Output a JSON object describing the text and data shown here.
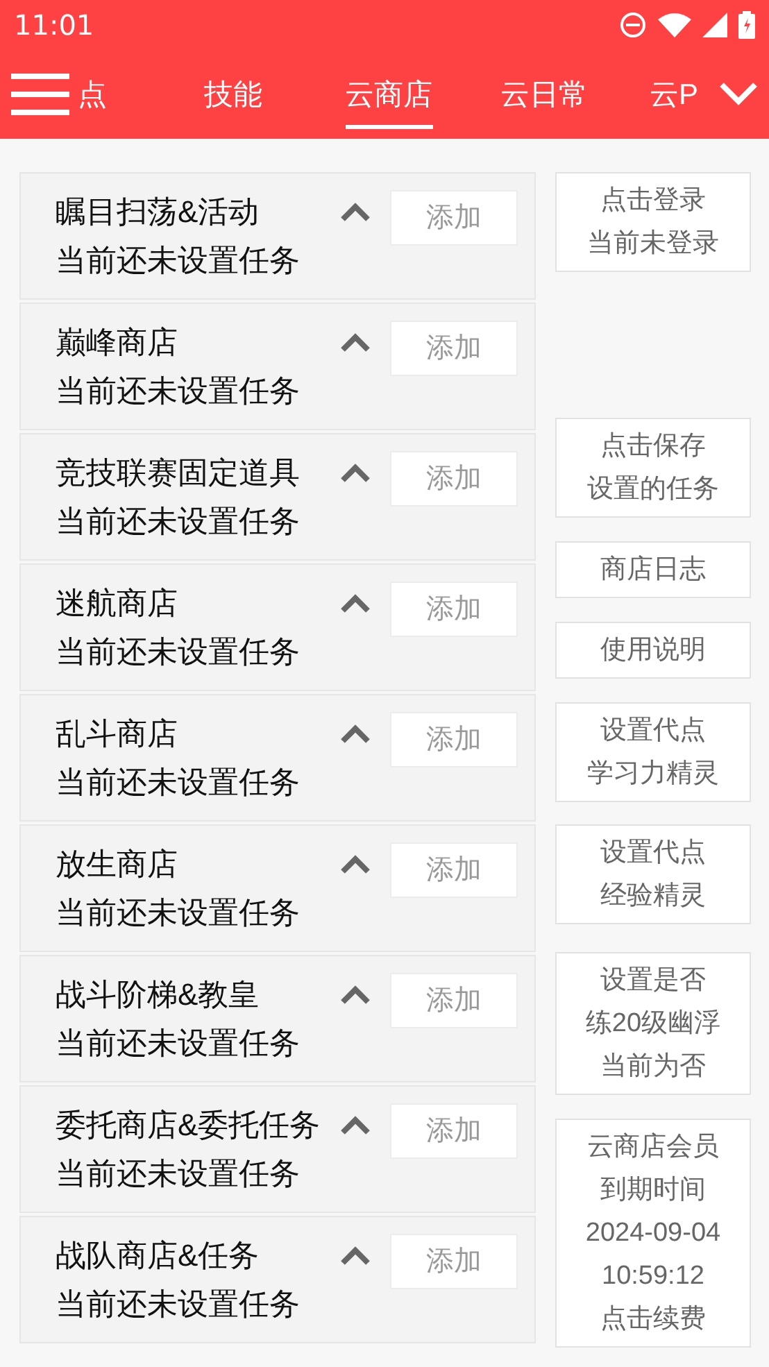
{
  "status_bar": {
    "time": "11:01"
  },
  "tabs": [
    {
      "label": "点",
      "selected": false
    },
    {
      "label": "技能",
      "selected": false
    },
    {
      "label": "云商店",
      "selected": true
    },
    {
      "label": "云日常",
      "selected": false
    },
    {
      "label": "云P",
      "selected": false
    }
  ],
  "tasks": [
    {
      "title": "瞩目扫荡&活动",
      "status": "当前还未设置任务",
      "button": "添加"
    },
    {
      "title": "巅峰商店",
      "status": "当前还未设置任务",
      "button": "添加"
    },
    {
      "title": "竞技联赛固定道具",
      "status": "当前还未设置任务",
      "button": "添加"
    },
    {
      "title": "迷航商店",
      "status": "当前还未设置任务",
      "button": "添加"
    },
    {
      "title": "乱斗商店",
      "status": "当前还未设置任务",
      "button": "添加"
    },
    {
      "title": "放生商店",
      "status": "当前还未设置任务",
      "button": "添加"
    },
    {
      "title": "战斗阶梯&教皇",
      "status": "当前还未设置任务",
      "button": "添加"
    },
    {
      "title": "委托商店&委托任务",
      "status": "当前还未设置任务",
      "button": "添加"
    },
    {
      "title": "战队商店&任务",
      "status": "当前还未设置任务",
      "button": "添加"
    }
  ],
  "side_buttons": [
    {
      "lines": [
        "点击登录",
        "当前未登录"
      ]
    },
    {
      "lines": [
        "点击保存",
        "设置的任务"
      ]
    },
    {
      "lines": [
        "商店日志"
      ]
    },
    {
      "lines": [
        "使用说明"
      ]
    },
    {
      "lines": [
        "设置代点",
        "学习力精灵"
      ]
    },
    {
      "lines": [
        "设置代点",
        "经验精灵"
      ]
    },
    {
      "lines": [
        "设置是否",
        "练20级幽浮",
        "当前为否"
      ]
    },
    {
      "lines": [
        "云商店会员",
        "到期时间",
        "2024-09-04",
        "10:59:12",
        "点击续费"
      ]
    }
  ]
}
